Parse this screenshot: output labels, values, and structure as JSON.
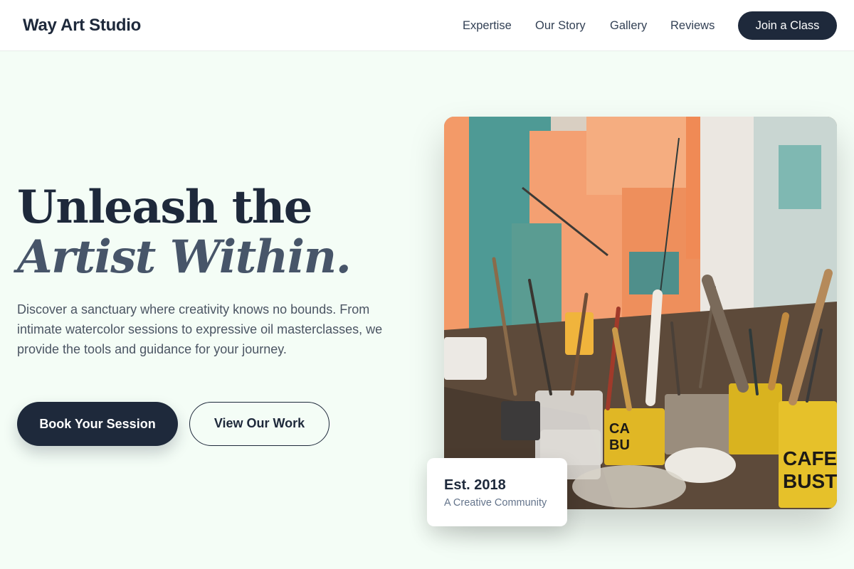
{
  "header": {
    "brand": "Way Art Studio",
    "nav": [
      "Expertise",
      "Our Story",
      "Gallery",
      "Reviews"
    ],
    "cta_label": "Join a Class"
  },
  "hero": {
    "title_line1": "Unleash the",
    "title_line2": "Artist Within.",
    "description": "Discover a sanctuary where creativity knows no bounds. From intimate watercolor sessions to expressive oil masterclasses, we provide the tools and guidance for your journey.",
    "primary_button": "Book Your Session",
    "secondary_button": "View Our Work"
  },
  "image": {
    "alt": "Art studio table with paint brushes in cans and jars",
    "can_label_1": "CAFE",
    "can_label_2": "BUSTE",
    "can_label_3": "CA",
    "can_label_4": "BU"
  },
  "badge": {
    "title": "Est. 2018",
    "subtitle": "A Creative Community"
  },
  "colors": {
    "background": "#f4fdf6",
    "primary": "#1e293b",
    "secondary_text": "#475569",
    "muted_text": "#64748b"
  }
}
